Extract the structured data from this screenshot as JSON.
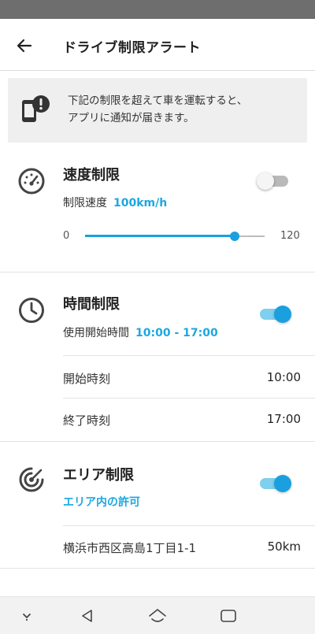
{
  "app": {
    "title": "ドライブ制限アラート"
  },
  "notice": {
    "line1": "下記の制限を超えて車を運転すると、",
    "line2": "アプリに通知が届きます。",
    "icon": "phone-alert-icon"
  },
  "speed_limit": {
    "title": "速度制限",
    "icon": "speedometer-icon",
    "enabled": false,
    "label": "制限速度",
    "value": "100km/h",
    "slider_min": "0",
    "slider_max": "120",
    "slider_value": 100
  },
  "time_limit": {
    "title": "時間制限",
    "icon": "clock-icon",
    "enabled": true,
    "label": "使用開始時間",
    "value": "10:00 - 17:00",
    "rows": [
      {
        "label": "開始時刻",
        "value": "10:00"
      },
      {
        "label": "終了時刻",
        "value": "17:00"
      }
    ]
  },
  "area_limit": {
    "title": "エリア制限",
    "icon": "target-icon",
    "enabled": true,
    "permission": "エリア内の許可",
    "location": "横浜市西区高島1丁目1-1",
    "radius": "50km"
  },
  "colors": {
    "accent": "#1aa0de",
    "accent_light": "#7fcfee"
  },
  "navbar": {
    "icons": [
      "chevron-down-icon",
      "back-triangle-icon",
      "home-icon",
      "recents-icon"
    ]
  }
}
